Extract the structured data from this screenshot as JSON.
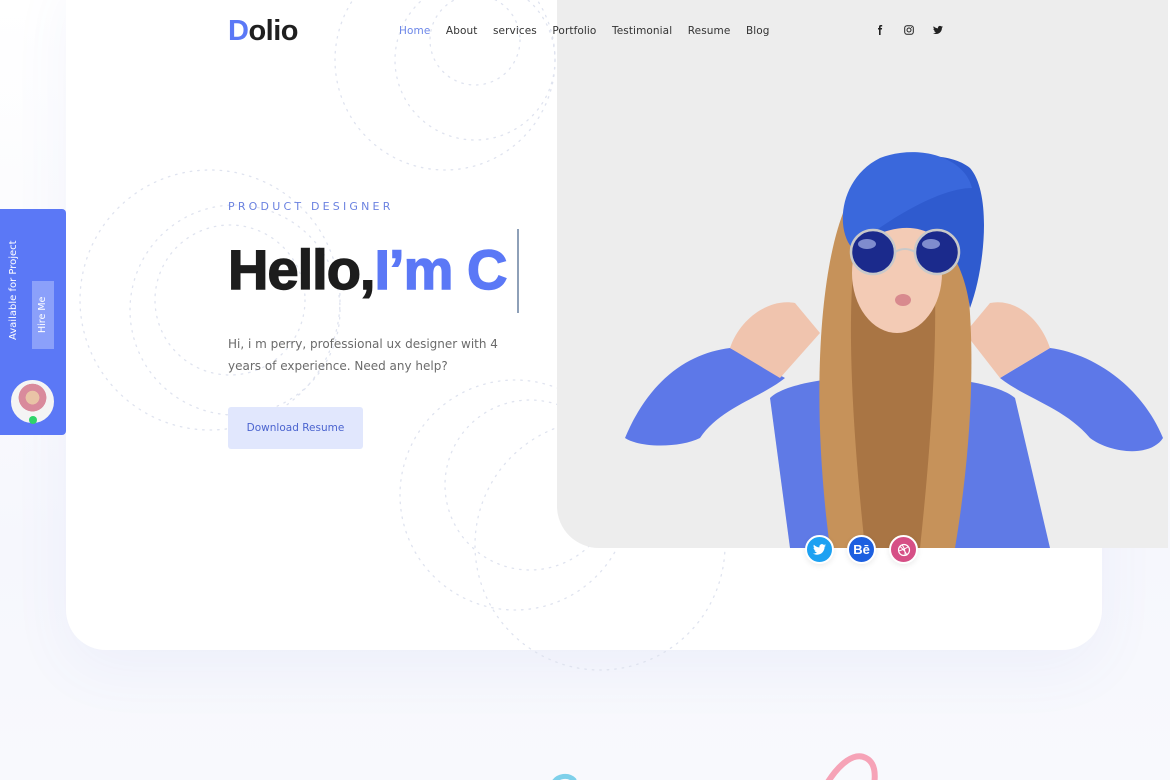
{
  "brand": {
    "logo_first": "D",
    "logo_rest": "olio",
    "accent_color": "#5b78f6"
  },
  "nav": {
    "items": [
      {
        "label": "Home",
        "active": true
      },
      {
        "label": "About",
        "active": false
      },
      {
        "label": "services",
        "active": false
      },
      {
        "label": "Portfolio",
        "active": false
      },
      {
        "label": "Testimonial",
        "active": false
      },
      {
        "label": "Resume",
        "active": false
      },
      {
        "label": "Blog",
        "active": false
      }
    ],
    "social": [
      "facebook-icon",
      "instagram-icon",
      "twitter-icon"
    ]
  },
  "hero": {
    "subtitle": "PRODUCT DESIGNER",
    "headline_part1": "Hello,",
    "headline_part2": "I’m ",
    "headline_partial": "C",
    "description": "Hi, i m perry, professional ux designer with 4 years of experience. Need any help?",
    "download_button": "Download Resume"
  },
  "side_widget": {
    "label": "Available for Project",
    "hire_button": "Hire Me",
    "status": "online",
    "status_color": "#2fd36a"
  },
  "profile_social": [
    {
      "name": "twitter",
      "icon": "twitter-icon",
      "color": "#1da1f2"
    },
    {
      "name": "behance",
      "icon": "behance-icon",
      "label": "Bē",
      "color": "#1c5fe0"
    },
    {
      "name": "dribbble",
      "icon": "dribbble-icon",
      "color": "#d64f86"
    }
  ]
}
